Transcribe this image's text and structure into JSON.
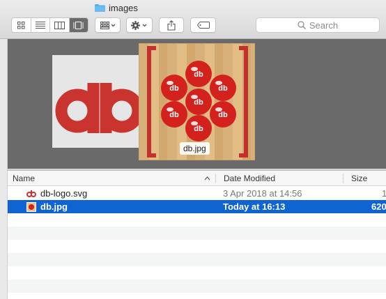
{
  "window": {
    "title": "images"
  },
  "toolbar": {
    "view_modes": [
      {
        "icon": "icon-view-icon",
        "active": false
      },
      {
        "icon": "list-view-icon",
        "active": false
      },
      {
        "icon": "column-view-icon",
        "active": false
      },
      {
        "icon": "gallery-view-icon",
        "active": true
      }
    ],
    "arrange_icon": "arrange-grid-icon",
    "action_icon": "gear-icon",
    "share_icon": "share-icon",
    "tags_icon": "tag-icon",
    "search_placeholder": "Search"
  },
  "preview": {
    "photo_label": "db.jpg",
    "logo_letters": "db"
  },
  "columns": {
    "name": "Name",
    "date_modified": "Date Modified",
    "size": "Size"
  },
  "files": [
    {
      "name": "db-logo.svg",
      "date": "3 Apr 2018 at 14:56",
      "size": "1",
      "icon": "svg-file-icon",
      "selected": false
    },
    {
      "name": "db.jpg",
      "date": "Today at 16:13",
      "size": "620",
      "icon": "jpg-file-icon",
      "selected": true
    }
  ],
  "colors": {
    "accent": "#0f64d2",
    "brand_red": "#c9342f",
    "preview_bg": "#6a6a6a"
  }
}
